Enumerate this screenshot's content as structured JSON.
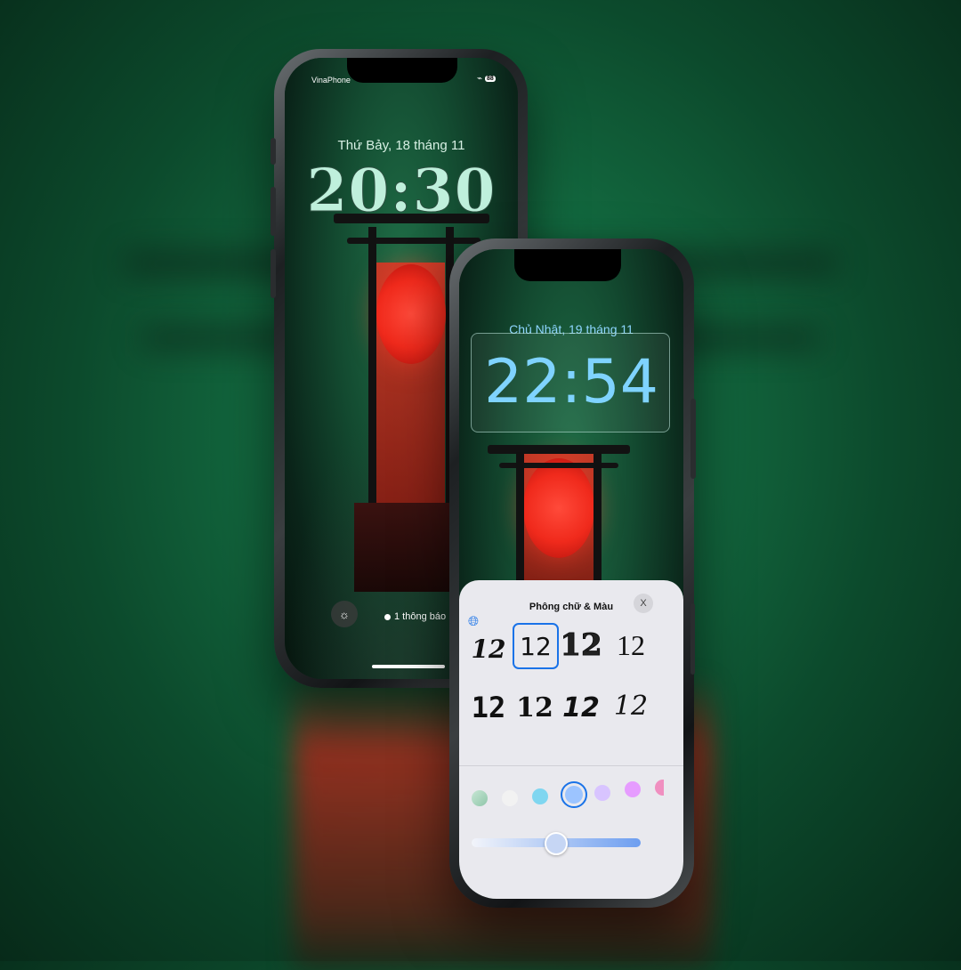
{
  "back_phone": {
    "carrier": "VinaPhone",
    "battery": "88",
    "date": "Thứ Bảy, 18 tháng 11",
    "time": "20:30",
    "notification": "1 thông báo"
  },
  "front_phone": {
    "date": "Chủ Nhật, 19 tháng 11",
    "time": "22:54",
    "panel": {
      "title": "Phông chữ & Màu",
      "close": "X",
      "font_samples": [
        "12",
        "12",
        "12",
        "12",
        "12",
        "12",
        "12",
        "12"
      ],
      "selected_font_index": 1,
      "swatches": [
        "#a9d8c0",
        "#f2f2f2",
        "#7fd6f0",
        "#9cc4ff",
        "#d8c4ff",
        "#e69cff",
        "#f08fc0"
      ],
      "selected_swatch_index": 3,
      "slider_value": 0.49
    }
  },
  "colors": {
    "back_clock": "#bff0dc",
    "front_clock": "#7fd3ff",
    "accent": "#1a73e8"
  }
}
